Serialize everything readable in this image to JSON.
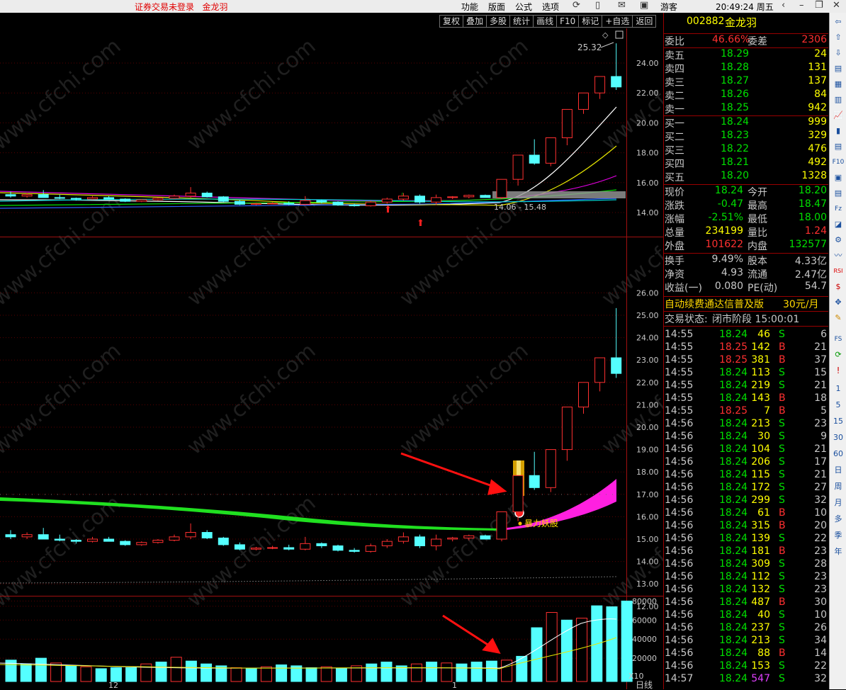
{
  "titlebar": {
    "app_title": "证券交易未登录",
    "stock_name": "金龙羽",
    "menu": [
      "功能",
      "版面",
      "公式",
      "选项"
    ],
    "user": "游客",
    "clock": "20:49:24 周五"
  },
  "chart_toolbar": [
    "复权",
    "叠加",
    "多股",
    "统计",
    "画线",
    "F10",
    "标记",
    "+自选",
    "返回"
  ],
  "main_chart": {
    "y_ticks": [
      "24.00",
      "22.00",
      "20.00",
      "18.00",
      "16.00",
      "14.00"
    ],
    "max_label": "25.32",
    "range_label": "14.06 - 15.48"
  },
  "indicator_chart": {
    "y_ticks": [
      "26.00",
      "25.00",
      "24.00",
      "23.00",
      "22.00",
      "21.00",
      "20.00",
      "19.00",
      "18.00",
      "17.00",
      "16.00",
      "15.00",
      "14.00",
      "13.00",
      "12.00"
    ],
    "signal_label": "暴力妖股"
  },
  "volume_chart": {
    "y_ticks": [
      "80000",
      "60000",
      "40000",
      "20000"
    ],
    "zoom_label": "X10",
    "x_labels": [
      "12",
      "1"
    ],
    "period_label": "日线"
  },
  "quote": {
    "code": "002882",
    "name": "金龙羽",
    "weibi_label": "委比",
    "weibi_value": "46.66%",
    "weicha_label": "委差",
    "weicha_value": "2306",
    "asks": [
      {
        "label": "卖五",
        "price": "18.29",
        "vol": "24"
      },
      {
        "label": "卖四",
        "price": "18.28",
        "vol": "131"
      },
      {
        "label": "卖三",
        "price": "18.27",
        "vol": "137"
      },
      {
        "label": "卖二",
        "price": "18.26",
        "vol": "84"
      },
      {
        "label": "卖一",
        "price": "18.25",
        "vol": "942"
      }
    ],
    "bids": [
      {
        "label": "买一",
        "price": "18.24",
        "vol": "999"
      },
      {
        "label": "买二",
        "price": "18.23",
        "vol": "329"
      },
      {
        "label": "买三",
        "price": "18.22",
        "vol": "476"
      },
      {
        "label": "买四",
        "price": "18.21",
        "vol": "492"
      },
      {
        "label": "买五",
        "price": "18.20",
        "vol": "1328"
      }
    ],
    "stats": [
      {
        "l1": "现价",
        "v1": "18.24",
        "l2": "今开",
        "v2": "18.20",
        "c1": "#00e000",
        "c2": "#00e000"
      },
      {
        "l1": "涨跌",
        "v1": "-0.47",
        "l2": "最高",
        "v2": "18.47",
        "c1": "#00e000",
        "c2": "#00e000"
      },
      {
        "l1": "涨幅",
        "v1": "-2.51%",
        "l2": "最低",
        "v2": "18.00",
        "c1": "#00e000",
        "c2": "#00e000"
      },
      {
        "l1": "总量",
        "v1": "234199",
        "l2": "量比",
        "v2": "1.24",
        "c1": "#ffff00",
        "c2": "#ff3030"
      },
      {
        "l1": "外盘",
        "v1": "101622",
        "l2": "内盘",
        "v2": "132577",
        "c1": "#ff3030",
        "c2": "#00e000"
      }
    ],
    "fundamentals": [
      {
        "l1": "换手",
        "v1": "9.49%",
        "l2": "股本",
        "v2": "4.33亿"
      },
      {
        "l1": "净资",
        "v1": "4.93",
        "l2": "流通",
        "v2": "2.47亿"
      },
      {
        "l1": "收益(一)",
        "v1": "0.080",
        "l2": "PE(动)",
        "v2": "54.7"
      }
    ],
    "promo": "自动续费通达信普及版",
    "promo_price": "30元/月",
    "status_label": "交易状态:",
    "status_value": "闭市阶段 15:00:01"
  },
  "ticks": [
    {
      "time": "14:55",
      "price": "18.24",
      "vol": "46",
      "bs": "S",
      "n": "6"
    },
    {
      "time": "14:55",
      "price": "18.25",
      "vol": "142",
      "bs": "B",
      "n": "21"
    },
    {
      "time": "14:55",
      "price": "18.25",
      "vol": "381",
      "bs": "B",
      "n": "37"
    },
    {
      "time": "14:55",
      "price": "18.24",
      "vol": "113",
      "bs": "S",
      "n": "15"
    },
    {
      "time": "14:55",
      "price": "18.24",
      "vol": "219",
      "bs": "S",
      "n": "21"
    },
    {
      "time": "14:55",
      "price": "18.24",
      "vol": "143",
      "bs": "B",
      "n": "18"
    },
    {
      "time": "14:55",
      "price": "18.25",
      "vol": "7",
      "bs": "B",
      "n": "5"
    },
    {
      "time": "14:56",
      "price": "18.24",
      "vol": "213",
      "bs": "S",
      "n": "23"
    },
    {
      "time": "14:56",
      "price": "18.24",
      "vol": "30",
      "bs": "S",
      "n": "9"
    },
    {
      "time": "14:56",
      "price": "18.24",
      "vol": "104",
      "bs": "S",
      "n": "21"
    },
    {
      "time": "14:56",
      "price": "18.24",
      "vol": "206",
      "bs": "S",
      "n": "17"
    },
    {
      "time": "14:56",
      "price": "18.24",
      "vol": "115",
      "bs": "S",
      "n": "21"
    },
    {
      "time": "14:56",
      "price": "18.24",
      "vol": "172",
      "bs": "S",
      "n": "27"
    },
    {
      "time": "14:56",
      "price": "18.24",
      "vol": "299",
      "bs": "S",
      "n": "32"
    },
    {
      "time": "14:56",
      "price": "18.24",
      "vol": "61",
      "bs": "B",
      "n": "10"
    },
    {
      "time": "14:56",
      "price": "18.24",
      "vol": "315",
      "bs": "B",
      "n": "20"
    },
    {
      "time": "14:56",
      "price": "18.24",
      "vol": "139",
      "bs": "S",
      "n": "22"
    },
    {
      "time": "14:56",
      "price": "18.24",
      "vol": "181",
      "bs": "B",
      "n": "23"
    },
    {
      "time": "14:56",
      "price": "18.24",
      "vol": "309",
      "bs": "S",
      "n": "28"
    },
    {
      "time": "14:56",
      "price": "18.24",
      "vol": "112",
      "bs": "S",
      "n": "23"
    },
    {
      "time": "14:56",
      "price": "18.24",
      "vol": "132",
      "bs": "S",
      "n": "23"
    },
    {
      "time": "14:56",
      "price": "18.24",
      "vol": "487",
      "bs": "B",
      "n": "30"
    },
    {
      "time": "14:56",
      "price": "18.24",
      "vol": "40",
      "bs": "S",
      "n": "10"
    },
    {
      "time": "14:56",
      "price": "18.24",
      "vol": "237",
      "bs": "S",
      "n": "26"
    },
    {
      "time": "14:56",
      "price": "18.24",
      "vol": "213",
      "bs": "S",
      "n": "34"
    },
    {
      "time": "14:56",
      "price": "18.24",
      "vol": "88",
      "bs": "B",
      "n": "14"
    },
    {
      "time": "14:56",
      "price": "18.24",
      "vol": "153",
      "bs": "S",
      "n": "22"
    },
    {
      "time": "14:57",
      "price": "18.24",
      "vol": "547",
      "bs": "S",
      "n": "32"
    }
  ],
  "sidebar_periods": [
    "1",
    "5",
    "15",
    "30",
    "60",
    "日",
    "周",
    "月",
    "多",
    "季",
    "年"
  ],
  "candles": [
    [
      15.2,
      15.4,
      15.0,
      15.1
    ],
    [
      15.1,
      15.3,
      15.0,
      15.2
    ],
    [
      15.2,
      15.5,
      15.0,
      15.0
    ],
    [
      15.0,
      15.2,
      14.9,
      14.95
    ],
    [
      14.95,
      15.0,
      14.8,
      14.9
    ],
    [
      14.9,
      15.1,
      14.85,
      15.0
    ],
    [
      15.0,
      15.1,
      14.9,
      14.9
    ],
    [
      14.9,
      14.95,
      14.7,
      14.75
    ],
    [
      14.75,
      14.9,
      14.7,
      14.85
    ],
    [
      14.85,
      15.0,
      14.8,
      14.95
    ],
    [
      14.95,
      15.2,
      14.9,
      15.1
    ],
    [
      15.1,
      15.7,
      15.0,
      15.3
    ],
    [
      15.3,
      15.4,
      15.0,
      15.05
    ],
    [
      15.05,
      15.1,
      14.7,
      14.75
    ],
    [
      14.75,
      14.85,
      14.5,
      14.55
    ],
    [
      14.55,
      14.65,
      14.5,
      14.6
    ],
    [
      14.6,
      14.7,
      14.55,
      14.62
    ],
    [
      14.62,
      14.75,
      14.5,
      14.55
    ],
    [
      14.55,
      15.1,
      14.5,
      14.8
    ],
    [
      14.8,
      14.85,
      14.6,
      14.7
    ],
    [
      14.7,
      14.75,
      14.45,
      14.5
    ],
    [
      14.5,
      14.6,
      14.4,
      14.45
    ],
    [
      14.45,
      14.8,
      14.4,
      14.7
    ],
    [
      14.7,
      15.0,
      14.6,
      14.9
    ],
    [
      14.9,
      15.3,
      14.8,
      15.1
    ],
    [
      15.1,
      15.2,
      14.6,
      14.7
    ],
    [
      14.7,
      15.2,
      14.5,
      15.0
    ],
    [
      15.0,
      15.1,
      14.9,
      15.05
    ],
    [
      15.05,
      15.2,
      14.95,
      15.15
    ],
    [
      15.15,
      15.2,
      15.0,
      15.0
    ],
    [
      15.0,
      15.48,
      14.9,
      16.22
    ],
    [
      16.22,
      16.5,
      15.8,
      17.84
    ],
    [
      17.84,
      18.9,
      17.2,
      17.3
    ],
    [
      17.3,
      18.0,
      17.1,
      19.0
    ],
    [
      19.0,
      19.6,
      18.5,
      20.9
    ],
    [
      20.9,
      21.9,
      20.6,
      22.0
    ],
    [
      22.0,
      22.5,
      21.6,
      23.1
    ],
    [
      23.1,
      25.32,
      22.2,
      22.4
    ]
  ],
  "volumes": [
    18000,
    14000,
    20000,
    15000,
    12000,
    11000,
    9000,
    10000,
    10000,
    14000,
    16000,
    21000,
    17000,
    14000,
    12000,
    10000,
    9000,
    11000,
    13000,
    12000,
    10000,
    11000,
    9000,
    12000,
    14000,
    16000,
    12000,
    14000,
    16000,
    15000,
    14000,
    16000,
    17000,
    18000,
    22000,
    52000,
    68000,
    60000,
    62000,
    75000,
    74000,
    80000
  ]
}
